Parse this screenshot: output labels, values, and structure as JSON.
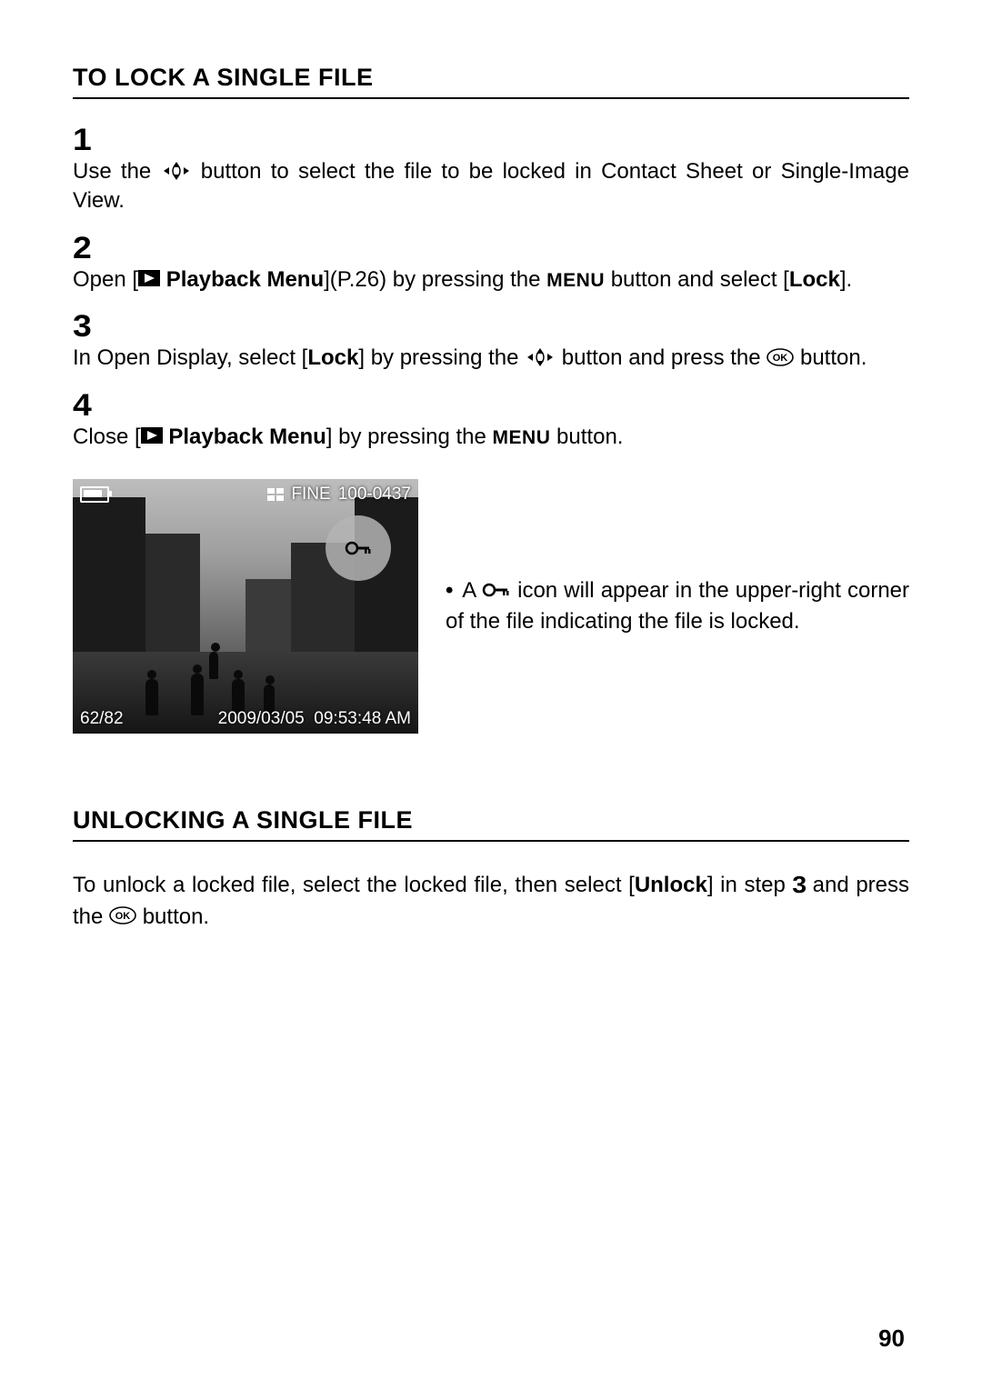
{
  "section1_title": "TO LOCK A SINGLE FILE",
  "section2_title": "UNLOCKING A SINGLE FILE",
  "step_numbers": [
    "1",
    "2",
    "3",
    "4"
  ],
  "step1": {
    "a": "Use the ",
    "b": " button to select the file to be locked in Contact Sheet or Single-Image View."
  },
  "step2": {
    "a": "Open [",
    "playback": " Playback Menu",
    "ref": "](P.26)",
    "b": " by pressing the ",
    "menu": "MENU",
    "c": " button and select [",
    "lock": "Lock",
    "d": "]."
  },
  "step3": {
    "a": "In Open Display, select [",
    "lock": "Lock",
    "b": "] by pressing the ",
    "c": " button and press the ",
    "d": " button."
  },
  "step4": {
    "a": "Close [",
    "playback": " Playback Menu",
    "b": "] by pressing the ",
    "menu": "MENU",
    "c": " button."
  },
  "shot": {
    "quality": "FINE",
    "file_no": "100-0437",
    "counter": "62/82",
    "date": "2009/03/05",
    "time": "09:53:48 AM"
  },
  "note": {
    "a": "A ",
    "b": " icon will appear in the upper-right corner of the file indicating the file is locked."
  },
  "unlock": {
    "a": "To unlock a locked file, select the locked file, then select [",
    "unlock_word": "Unlock",
    "b": "] in step ",
    "step_ref": "3",
    "c": " and press the ",
    "d": " button."
  },
  "page_number": "90"
}
